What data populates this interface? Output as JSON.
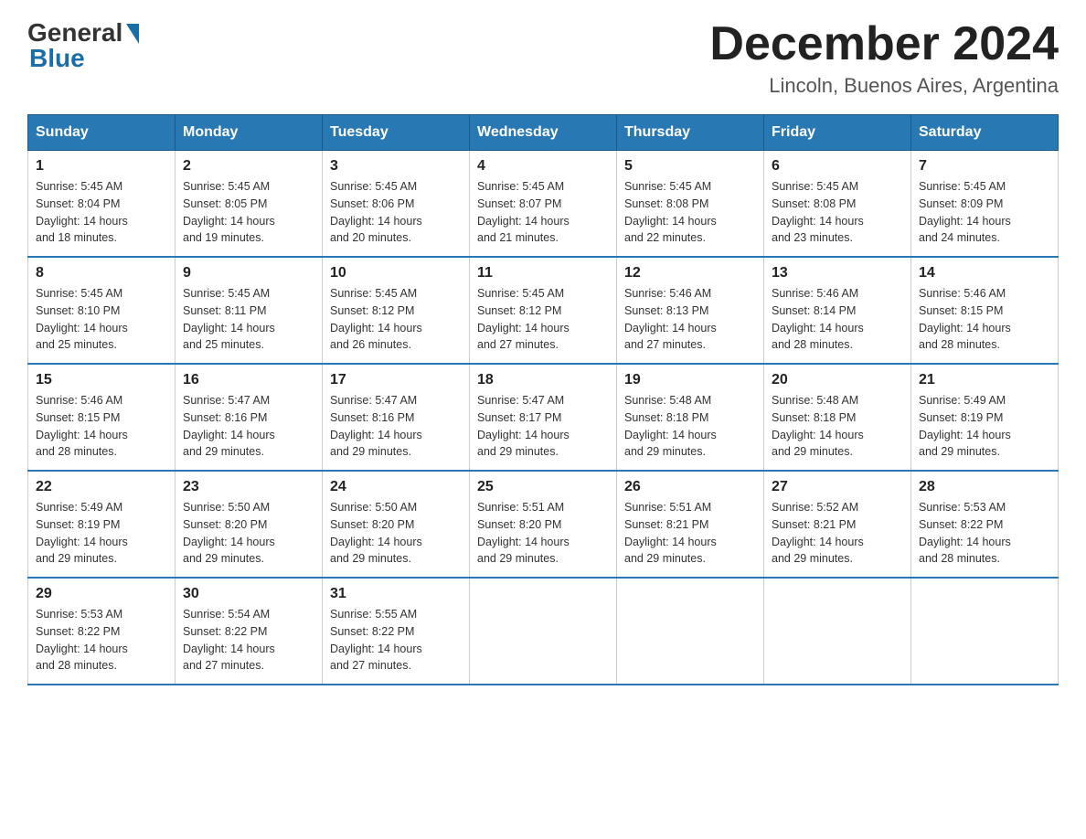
{
  "header": {
    "logo_general": "General",
    "logo_blue": "Blue",
    "month_year": "December 2024",
    "location": "Lincoln, Buenos Aires, Argentina"
  },
  "weekdays": [
    "Sunday",
    "Monday",
    "Tuesday",
    "Wednesday",
    "Thursday",
    "Friday",
    "Saturday"
  ],
  "weeks": [
    [
      {
        "day": "1",
        "sunrise": "5:45 AM",
        "sunset": "8:04 PM",
        "daylight": "14 hours and 18 minutes."
      },
      {
        "day": "2",
        "sunrise": "5:45 AM",
        "sunset": "8:05 PM",
        "daylight": "14 hours and 19 minutes."
      },
      {
        "day": "3",
        "sunrise": "5:45 AM",
        "sunset": "8:06 PM",
        "daylight": "14 hours and 20 minutes."
      },
      {
        "day": "4",
        "sunrise": "5:45 AM",
        "sunset": "8:07 PM",
        "daylight": "14 hours and 21 minutes."
      },
      {
        "day": "5",
        "sunrise": "5:45 AM",
        "sunset": "8:08 PM",
        "daylight": "14 hours and 22 minutes."
      },
      {
        "day": "6",
        "sunrise": "5:45 AM",
        "sunset": "8:08 PM",
        "daylight": "14 hours and 23 minutes."
      },
      {
        "day": "7",
        "sunrise": "5:45 AM",
        "sunset": "8:09 PM",
        "daylight": "14 hours and 24 minutes."
      }
    ],
    [
      {
        "day": "8",
        "sunrise": "5:45 AM",
        "sunset": "8:10 PM",
        "daylight": "14 hours and 25 minutes."
      },
      {
        "day": "9",
        "sunrise": "5:45 AM",
        "sunset": "8:11 PM",
        "daylight": "14 hours and 25 minutes."
      },
      {
        "day": "10",
        "sunrise": "5:45 AM",
        "sunset": "8:12 PM",
        "daylight": "14 hours and 26 minutes."
      },
      {
        "day": "11",
        "sunrise": "5:45 AM",
        "sunset": "8:12 PM",
        "daylight": "14 hours and 27 minutes."
      },
      {
        "day": "12",
        "sunrise": "5:46 AM",
        "sunset": "8:13 PM",
        "daylight": "14 hours and 27 minutes."
      },
      {
        "day": "13",
        "sunrise": "5:46 AM",
        "sunset": "8:14 PM",
        "daylight": "14 hours and 28 minutes."
      },
      {
        "day": "14",
        "sunrise": "5:46 AM",
        "sunset": "8:15 PM",
        "daylight": "14 hours and 28 minutes."
      }
    ],
    [
      {
        "day": "15",
        "sunrise": "5:46 AM",
        "sunset": "8:15 PM",
        "daylight": "14 hours and 28 minutes."
      },
      {
        "day": "16",
        "sunrise": "5:47 AM",
        "sunset": "8:16 PM",
        "daylight": "14 hours and 29 minutes."
      },
      {
        "day": "17",
        "sunrise": "5:47 AM",
        "sunset": "8:16 PM",
        "daylight": "14 hours and 29 minutes."
      },
      {
        "day": "18",
        "sunrise": "5:47 AM",
        "sunset": "8:17 PM",
        "daylight": "14 hours and 29 minutes."
      },
      {
        "day": "19",
        "sunrise": "5:48 AM",
        "sunset": "8:18 PM",
        "daylight": "14 hours and 29 minutes."
      },
      {
        "day": "20",
        "sunrise": "5:48 AM",
        "sunset": "8:18 PM",
        "daylight": "14 hours and 29 minutes."
      },
      {
        "day": "21",
        "sunrise": "5:49 AM",
        "sunset": "8:19 PM",
        "daylight": "14 hours and 29 minutes."
      }
    ],
    [
      {
        "day": "22",
        "sunrise": "5:49 AM",
        "sunset": "8:19 PM",
        "daylight": "14 hours and 29 minutes."
      },
      {
        "day": "23",
        "sunrise": "5:50 AM",
        "sunset": "8:20 PM",
        "daylight": "14 hours and 29 minutes."
      },
      {
        "day": "24",
        "sunrise": "5:50 AM",
        "sunset": "8:20 PM",
        "daylight": "14 hours and 29 minutes."
      },
      {
        "day": "25",
        "sunrise": "5:51 AM",
        "sunset": "8:20 PM",
        "daylight": "14 hours and 29 minutes."
      },
      {
        "day": "26",
        "sunrise": "5:51 AM",
        "sunset": "8:21 PM",
        "daylight": "14 hours and 29 minutes."
      },
      {
        "day": "27",
        "sunrise": "5:52 AM",
        "sunset": "8:21 PM",
        "daylight": "14 hours and 29 minutes."
      },
      {
        "day": "28",
        "sunrise": "5:53 AM",
        "sunset": "8:22 PM",
        "daylight": "14 hours and 28 minutes."
      }
    ],
    [
      {
        "day": "29",
        "sunrise": "5:53 AM",
        "sunset": "8:22 PM",
        "daylight": "14 hours and 28 minutes."
      },
      {
        "day": "30",
        "sunrise": "5:54 AM",
        "sunset": "8:22 PM",
        "daylight": "14 hours and 27 minutes."
      },
      {
        "day": "31",
        "sunrise": "5:55 AM",
        "sunset": "8:22 PM",
        "daylight": "14 hours and 27 minutes."
      },
      null,
      null,
      null,
      null
    ]
  ],
  "labels": {
    "sunrise": "Sunrise:",
    "sunset": "Sunset:",
    "daylight": "Daylight:"
  }
}
